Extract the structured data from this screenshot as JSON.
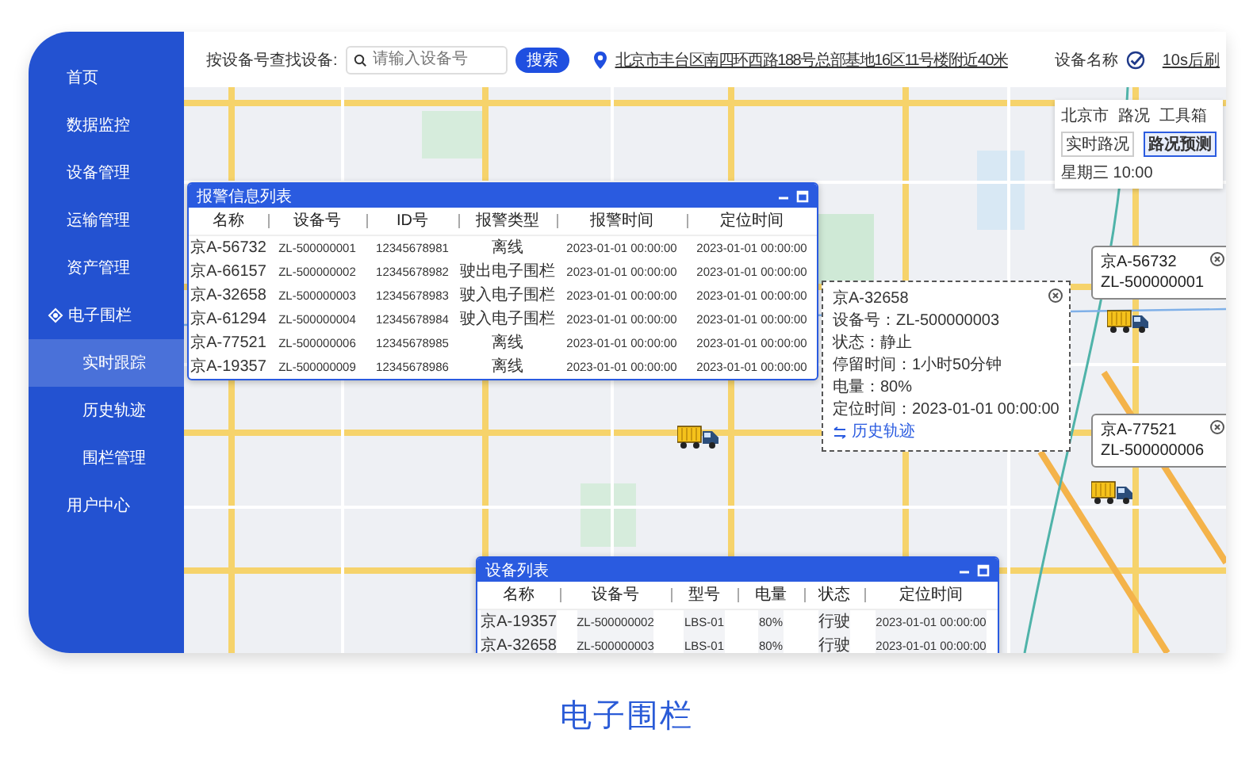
{
  "sidebar": {
    "items": [
      {
        "label": "首页",
        "selected": false
      },
      {
        "label": "数据监控",
        "selected": false
      },
      {
        "label": "设备管理",
        "selected": false
      },
      {
        "label": "运输管理",
        "selected": false
      },
      {
        "label": "资产管理",
        "selected": false
      },
      {
        "label": "电子围栏",
        "selected": false,
        "expanded": true,
        "children": [
          {
            "label": "实时跟踪",
            "selected": true
          },
          {
            "label": "历史轨迹",
            "selected": false
          },
          {
            "label": "围栏管理",
            "selected": false
          }
        ]
      },
      {
        "label": "用户中心",
        "selected": false
      }
    ]
  },
  "topbar": {
    "search_label": "按设备号查找设备:",
    "search": {
      "placeholder": "请输入设备号"
    },
    "search_button": "搜索",
    "address": "北京市丰台区南四环西路188号总部基地16区11号楼附近40米",
    "device_name": {
      "label": "设备名称",
      "checked": true
    },
    "refresh": "10s后刷"
  },
  "map_tools": {
    "city": "北京市",
    "traffic": "路况",
    "toolbox": "工具箱",
    "tabs": [
      {
        "label": "实时路况",
        "selected": false
      },
      {
        "label": "路况预测",
        "selected": true
      }
    ],
    "time": "星期三 10:00"
  },
  "alert_panel": {
    "title": "报警信息列表",
    "columns": [
      "名称",
      "设备号",
      "ID号",
      "报警类型",
      "报警时间",
      "定位时间"
    ],
    "rows": [
      [
        "京A-56732",
        "ZL-500000001",
        "12345678981",
        "离线",
        "2023-01-01 00:00:00",
        "2023-01-01 00:00:00"
      ],
      [
        "京A-66157",
        "ZL-500000002",
        "12345678982",
        "驶出电子围栏",
        "2023-01-01 00:00:00",
        "2023-01-01 00:00:00"
      ],
      [
        "京A-32658",
        "ZL-500000003",
        "12345678983",
        "驶入电子围栏",
        "2023-01-01 00:00:00",
        "2023-01-01 00:00:00"
      ],
      [
        "京A-61294",
        "ZL-500000004",
        "12345678984",
        "驶入电子围栏",
        "2023-01-01 00:00:00",
        "2023-01-01 00:00:00"
      ],
      [
        "京A-77521",
        "ZL-500000006",
        "12345678985",
        "离线",
        "2023-01-01 00:00:00",
        "2023-01-01 00:00:00"
      ],
      [
        "京A-19357",
        "ZL-500000009",
        "12345678986",
        "离线",
        "2023-01-01 00:00:00",
        "2023-01-01 00:00:00"
      ]
    ]
  },
  "popup": {
    "title": "京A-32658",
    "fields": [
      "设备号：ZL-500000003",
      "状态：静止",
      "停留时间：1小时50分钟",
      "电量：80%",
      "定位时间：2023-01-01 00:00:00"
    ],
    "link": "历史轨迹"
  },
  "callouts": [
    {
      "plate": "京A-56732",
      "device": "ZL-500000001"
    },
    {
      "plate": "京A-77521",
      "device": "ZL-500000006"
    }
  ],
  "device_panel": {
    "title": "设备列表",
    "columns": [
      "名称",
      "设备号",
      "型号",
      "电量",
      "状态",
      "定位时间"
    ],
    "rows": [
      [
        "京A-19357",
        "ZL-500000002",
        "LBS-01",
        "80%",
        "行驶",
        "2023-01-01 00:00:00"
      ],
      [
        "京A-32658",
        "ZL-500000003",
        "LBS-01",
        "80%",
        "行驶",
        "2023-01-01 00:00:00"
      ]
    ]
  },
  "caption": "电子围栏"
}
